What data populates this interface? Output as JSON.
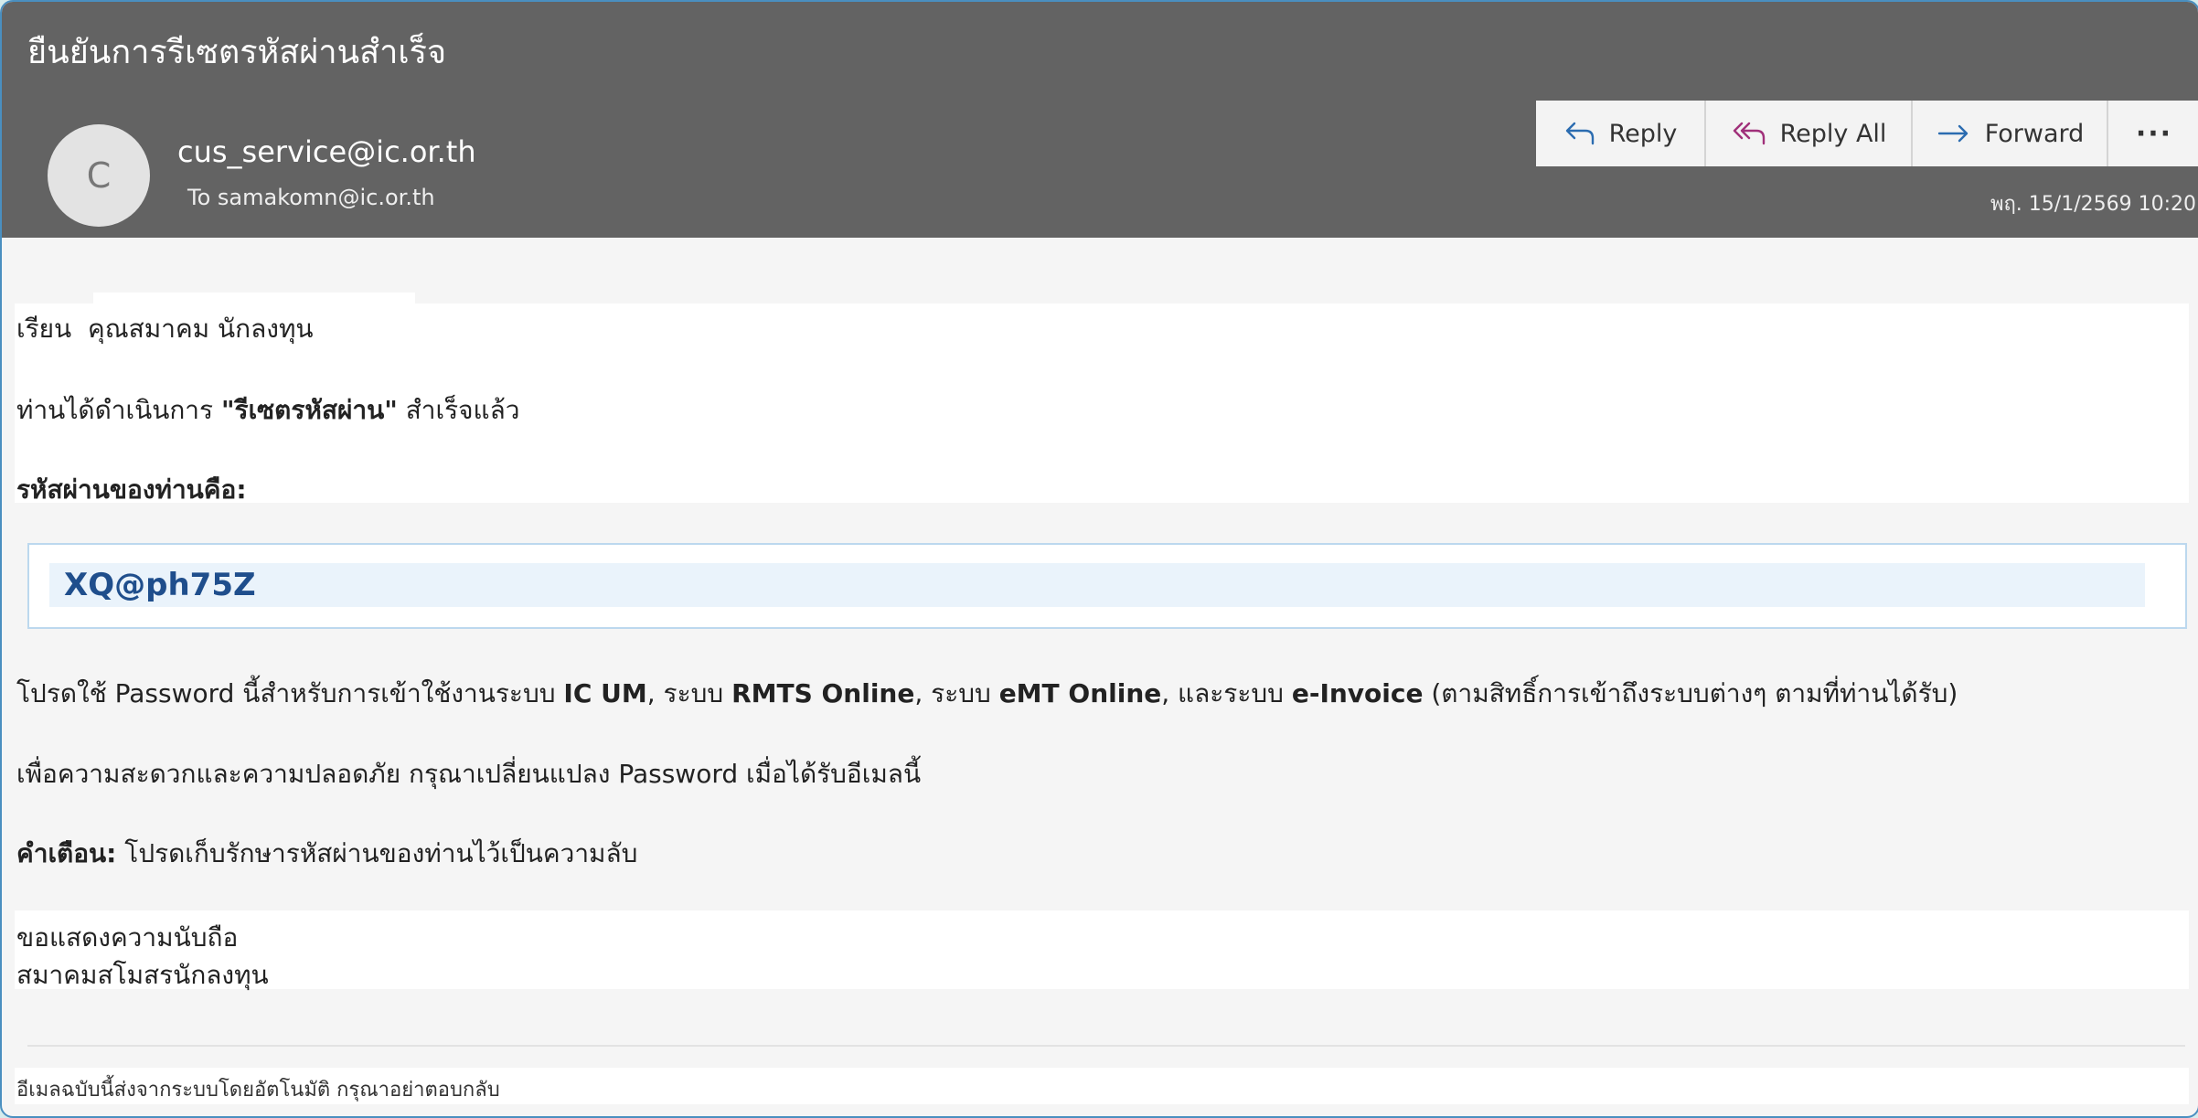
{
  "email": {
    "subject": "ยืนยันการรีเซตรหัสผ่านสำเร็จ",
    "sender_initial": "C",
    "sender": "cus_service@ic.or.th",
    "recipient": "To samakomn@ic.or.th",
    "timestamp": "พฤ. 15/1/2569 10:20"
  },
  "actions": {
    "reply": "Reply",
    "reply_all": "Reply All",
    "forward": "Forward",
    "more": "···"
  },
  "body": {
    "greeting_prefix": "เรียน",
    "greeting_name": "คุณสมาคม นักลงทุน",
    "line1_pre": "ท่านได้ดำเนินการ ",
    "line1_bold": "\"รีเซตรหัสผ่าน\"",
    "line1_post": " สำเร็จแล้ว",
    "password_label": "รหัสผ่านของท่านคือ:",
    "password": "XQ@ph75Z",
    "usage_1": "โปรดใช้ Password นี้สำหรับการเข้าใช้งานระบบ ",
    "usage_sys1": "IC UM",
    "usage_2": ", ระบบ ",
    "usage_sys2": "RMTS Online",
    "usage_3": ", ระบบ ",
    "usage_sys3": "eMT Online",
    "usage_4": ", และระบบ ",
    "usage_sys4": "e-Invoice",
    "usage_5": " (ตามสิทธิ์การเข้าถึงระบบต่างๆ ตามที่ท่านได้รับ)",
    "change_advice": "เพื่อความสะดวกและความปลอดภัย กรุณาเปลี่ยนแปลง Password เมื่อได้รับอีเมลนี้",
    "warning_label": "คำเตือน:",
    "warning_text": " โปรดเก็บรักษารหัสผ่านของท่านไว้เป็นความลับ",
    "closing": "ขอแสดงความนับถือ",
    "signature": "สมาคมสโมสรนักลงทุน",
    "footer": "อีเมลฉบับนี้ส่งจากระบบโดยอัตโนมัติ กรุณาอย่าตอบกลับ"
  }
}
